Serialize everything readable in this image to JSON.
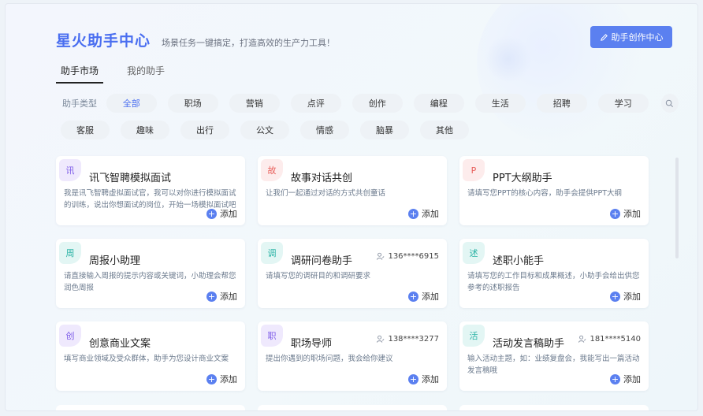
{
  "header": {
    "title": "星火助手中心",
    "subtitle": "场景任务一键搞定，打造高效的生产力工具！",
    "create_button": "助手创作中心"
  },
  "tabs": [
    {
      "label": "助手市场",
      "active": true
    },
    {
      "label": "我的助手",
      "active": false
    }
  ],
  "filters": {
    "label": "助手类型",
    "row1": [
      "全部",
      "职场",
      "营销",
      "点评",
      "创作",
      "编程",
      "生活",
      "招聘",
      "学习"
    ],
    "row2": [
      "客服",
      "趣味",
      "出行",
      "公文",
      "情感",
      "脑暴",
      "其他"
    ],
    "active": "全部"
  },
  "add_label": "添加",
  "cards": [
    {
      "badge": "讯",
      "color": "purple",
      "title": "讯飞智聘模拟面试",
      "user": "",
      "desc": "我是讯飞智聘虚拟面试官，我可以对你进行模拟面试的训练，说出你想面试的岗位，开始一场模拟面试吧"
    },
    {
      "badge": "故",
      "color": "red",
      "title": "故事对话共创",
      "user": "",
      "desc": "让我们一起通过对话的方式共创童话"
    },
    {
      "badge": "P",
      "color": "red",
      "title": "PPT大纲助手",
      "user": "",
      "desc": "请填写您PPT的核心内容，助手会提供PPT大纲"
    },
    {
      "badge": "周",
      "color": "teal",
      "title": "周报小助理",
      "user": "",
      "desc": "请直接输入周报的提示内容或关键词，小助理会帮您润色周报"
    },
    {
      "badge": "调",
      "color": "teal",
      "title": "调研问卷助手",
      "user": "136****6915",
      "desc": "请填写您的调研目的和调研要求"
    },
    {
      "badge": "述",
      "color": "teal",
      "title": "述职小能手",
      "user": "",
      "desc": "请填写您的工作目标和成果概述，小助手会给出供您参考的述职报告"
    },
    {
      "badge": "创",
      "color": "purple",
      "title": "创意商业文案",
      "user": "",
      "desc": "填写商业领域及受众群体，助手为您设计商业文案"
    },
    {
      "badge": "职",
      "color": "purple",
      "title": "职场导师",
      "user": "138****3277",
      "desc": "提出你遇到的职场问题，我会给你建议"
    },
    {
      "badge": "活",
      "color": "teal",
      "title": "活动发言稿助手",
      "user": "181****5140",
      "desc": "输入活动主题，如：业绩复盘会，我能写出一篇活动发言稿哦"
    }
  ],
  "colors": {
    "accent": "#4a6ef0",
    "button": "#5b80f0"
  }
}
